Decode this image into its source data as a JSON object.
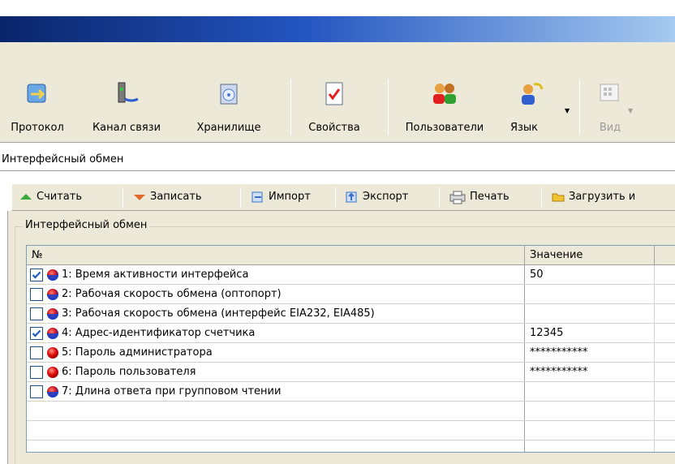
{
  "toolbar": {
    "items": [
      {
        "label": "Протокол",
        "icon": "protocol-icon"
      },
      {
        "label": "Канал связи",
        "icon": "channel-icon"
      },
      {
        "label": "Хранилище",
        "icon": "storage-icon"
      },
      {
        "label": "Свойства",
        "icon": "properties-icon"
      },
      {
        "label": "Пользователи",
        "icon": "users-icon"
      },
      {
        "label": "Язык",
        "icon": "language-icon"
      },
      {
        "label": "Вид",
        "icon": "view-icon"
      }
    ]
  },
  "caption": "Интерфейсный обмен",
  "actions": [
    {
      "label": "Считать",
      "icon": "read-icon"
    },
    {
      "label": "Записать",
      "icon": "write-icon"
    },
    {
      "label": "Импорт",
      "icon": "import-icon"
    },
    {
      "label": "Экспорт",
      "icon": "export-icon"
    },
    {
      "label": "Печать",
      "icon": "print-icon"
    },
    {
      "label": "Загрузить и",
      "icon": "folder-icon"
    }
  ],
  "group": {
    "title": "Интерфейсный обмен"
  },
  "grid": {
    "columns": [
      "№",
      "Значение"
    ],
    "rows": [
      {
        "checked": true,
        "bullet": "blue",
        "label": "1: Время активности интерфейса",
        "value": "50"
      },
      {
        "checked": false,
        "bullet": "blue",
        "label": "2: Рабочая скорость обмена (оптопорт)",
        "value": ""
      },
      {
        "checked": false,
        "bullet": "blue",
        "label": "3: Рабочая скорость обмена (интерфейс EIA232, EIA485)",
        "value": ""
      },
      {
        "checked": true,
        "bullet": "blue",
        "label": "4: Адрес-идентификатор счетчика",
        "value": "12345"
      },
      {
        "checked": false,
        "bullet": "red",
        "label": "5: Пароль администратора",
        "value": "***********"
      },
      {
        "checked": false,
        "bullet": "red",
        "label": "6: Пароль пользователя",
        "value": "***********"
      },
      {
        "checked": false,
        "bullet": "blue",
        "label": "7: Длина ответа при групповом чтении",
        "value": ""
      }
    ]
  },
  "colors": {
    "titlebar_left": "#0a246a",
    "titlebar_right": "#a6caf0",
    "face": "#ece9d8",
    "check": "#1a5fc0"
  }
}
